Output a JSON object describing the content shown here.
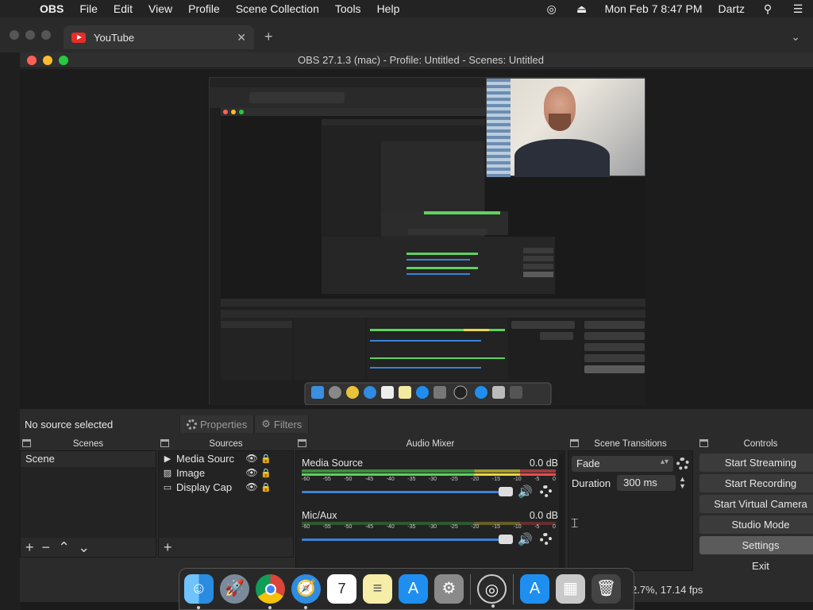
{
  "menubar": {
    "apple_icon": "apple-icon",
    "app_name": "OBS",
    "items": [
      "File",
      "Edit",
      "View",
      "Profile",
      "Scene Collection",
      "Tools",
      "Help"
    ],
    "datetime": "Mon Feb 7  8:47 PM",
    "user": "Dartz"
  },
  "browser": {
    "tab_title": "YouTube"
  },
  "obs": {
    "window_title": "OBS 27.1.3 (mac) - Profile: Untitled - Scenes: Untitled",
    "context_bar": {
      "no_source": "No source selected",
      "properties": "Properties",
      "filters": "Filters"
    },
    "docks": {
      "scenes": "Scenes",
      "sources": "Sources",
      "audio_mixer": "Audio Mixer",
      "scene_transitions": "Scene Transitions",
      "controls": "Controls"
    },
    "scenes": [
      "Scene"
    ],
    "sources": [
      {
        "name": "Media Sourc",
        "type_icon": "media-icon"
      },
      {
        "name": "Image",
        "type_icon": "image-icon"
      },
      {
        "name": "Display Cap",
        "type_icon": "display-icon"
      }
    ],
    "mixer": [
      {
        "name": "Media Source",
        "db": "0.0 dB",
        "volume": 1.0
      },
      {
        "name": "Mic/Aux",
        "db": "0.0 dB",
        "volume": 1.0
      }
    ],
    "meter_ticks": [
      "-60",
      "-55",
      "-50",
      "-45",
      "-40",
      "-35",
      "-30",
      "-25",
      "-20",
      "-15",
      "-10",
      "-5",
      "0"
    ],
    "transitions": {
      "selected": "Fade",
      "duration_label": "Duration",
      "duration_value": "300 ms"
    },
    "controls": [
      "Start Streaming",
      "Start Recording",
      "Start Virtual Camera",
      "Studio Mode",
      "Settings",
      "Exit"
    ],
    "status": "2.7%, 17.14 fps"
  },
  "dock_apps": [
    "Finder",
    "Launchpad",
    "Chrome",
    "Safari",
    "Calendar",
    "Notes",
    "App Store",
    "System Preferences",
    "OBS",
    "App Store",
    "Downloads",
    "Trash"
  ],
  "calendar_date": "7",
  "calendar_month": "FEB"
}
